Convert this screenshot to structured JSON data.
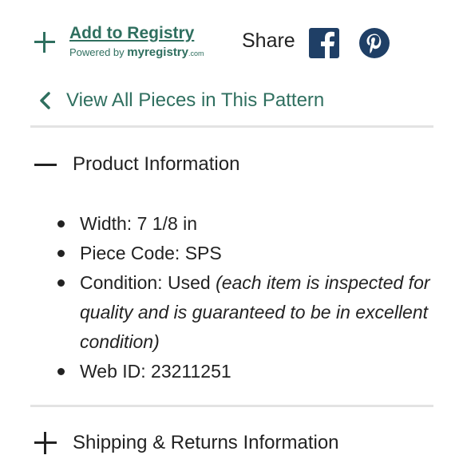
{
  "registry": {
    "add_label": "Add to Registry",
    "powered_by": "Powered by",
    "brand": "myregistry",
    "brand_suffix": ".com"
  },
  "share": {
    "label": "Share"
  },
  "nav": {
    "view_all_label": "View All Pieces in This Pattern"
  },
  "product_info": {
    "title": "Product Information",
    "items": [
      {
        "label": "Width:",
        "value": "7 1/8 in",
        "note": ""
      },
      {
        "label": "Piece Code:",
        "value": "SPS",
        "note": ""
      },
      {
        "label": "Condition:",
        "value": "Used",
        "note": "(each item is inspected for quality and is guaranteed to be in excellent condition)"
      },
      {
        "label": "Web ID:",
        "value": "23211251",
        "note": ""
      }
    ]
  },
  "shipping": {
    "title": "Shipping & Returns Information"
  },
  "colors": {
    "accent": "#2f6f5f",
    "social": "#1f3f66",
    "text": "#222222",
    "divider": "#e3e3e3"
  },
  "icons": [
    "plus-icon",
    "facebook-icon",
    "pinterest-icon",
    "chevron-left-icon",
    "minus-icon",
    "plus-icon"
  ]
}
